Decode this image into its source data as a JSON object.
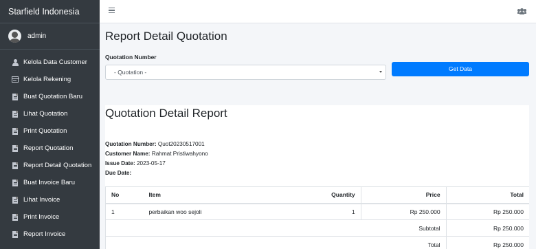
{
  "sidebar": {
    "brand": "Starfield Indonesia",
    "user_name": "admin",
    "items": [
      {
        "label": "Kelola Data Customer",
        "icon": "user-icon"
      },
      {
        "label": "Kelola Rekening",
        "icon": "credit-card-icon"
      },
      {
        "label": "Buat Quotation Baru",
        "icon": "file-icon"
      },
      {
        "label": "Lihat Quotation",
        "icon": "file-icon"
      },
      {
        "label": "Print Quotation",
        "icon": "file-icon"
      },
      {
        "label": "Report Quotation",
        "icon": "file-icon"
      },
      {
        "label": "Report Detail Quotation",
        "icon": "file-icon"
      },
      {
        "label": "Buat Invoice Baru",
        "icon": "file-icon"
      },
      {
        "label": "Lihat Invoice",
        "icon": "file-icon"
      },
      {
        "label": "Print Invoice",
        "icon": "file-icon"
      },
      {
        "label": "Report Invoice",
        "icon": "file-icon"
      }
    ]
  },
  "header": {
    "menu_icon": "hamburger-icon",
    "right_icon": "users-icon"
  },
  "main": {
    "page_title": "Report Detail Quotation",
    "quotation_label": "Quotation Number",
    "quotation_select_value": "- Quotation -",
    "get_data_label": "Get Data",
    "report_title": "Quotation Detail Report",
    "meta": {
      "quotation_number_label": "Quotation Number:",
      "quotation_number_value": "Quot20230517001",
      "customer_name_label": "Customer Name:",
      "customer_name_value": "Rahmat Pristiwahyono",
      "issue_date_label": "Issue Date:",
      "issue_date_value": "2023-05-17",
      "due_date_label": "Due Date:",
      "due_date_value": ""
    },
    "table": {
      "headers": [
        "No",
        "Item",
        "Quantity",
        "Price",
        "Total"
      ],
      "rows": [
        [
          "1",
          "perbaikan woo sejoli",
          "1",
          "Rp 250.000",
          "Rp 250.000"
        ]
      ],
      "subtotal_label": "Subtotal",
      "subtotal_value": "Rp 250.000",
      "total_label": "Total",
      "total_value": "Rp 250.000"
    }
  },
  "colors": {
    "sidebar_bg": "#343a40",
    "primary": "#007bff"
  }
}
